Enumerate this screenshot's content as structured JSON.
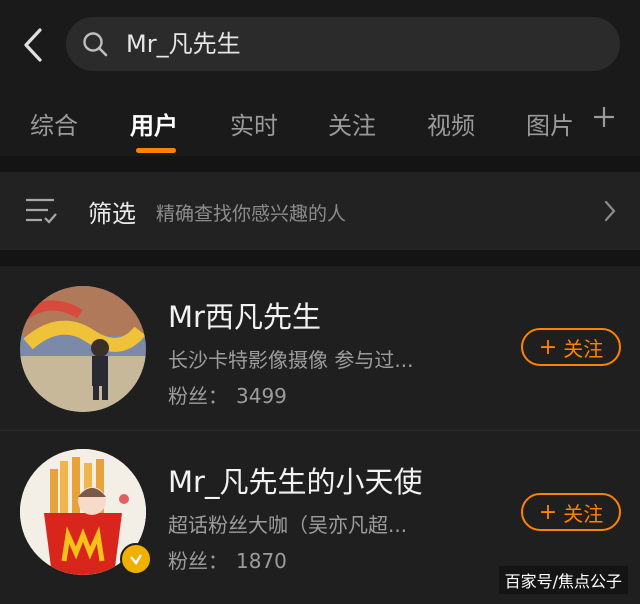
{
  "search": {
    "query": "Mr_凡先生"
  },
  "tabs": [
    {
      "label": "综合"
    },
    {
      "label": "用户"
    },
    {
      "label": "实时"
    },
    {
      "label": "关注"
    },
    {
      "label": "视频"
    },
    {
      "label": "图片"
    }
  ],
  "active_tab": "用户",
  "filter": {
    "label": "筛选",
    "description": "精确查找你感兴趣的人"
  },
  "users": [
    {
      "name": "Mr西凡先生",
      "desc": "长沙卡特影像摄像 参与过...",
      "fans_label": "粉丝：",
      "fans": "3499",
      "follow_label": "关注"
    },
    {
      "name": "Mr_凡先生的小天使",
      "desc": "超话粉丝大咖（吴亦凡超...",
      "fans_label": "粉丝：",
      "fans": "1870",
      "follow_label": "关注"
    }
  ],
  "watermark": "百家号/焦点公子",
  "colors": {
    "accent": "#ff8200",
    "background": "#141414",
    "verified": "#f0b000"
  }
}
